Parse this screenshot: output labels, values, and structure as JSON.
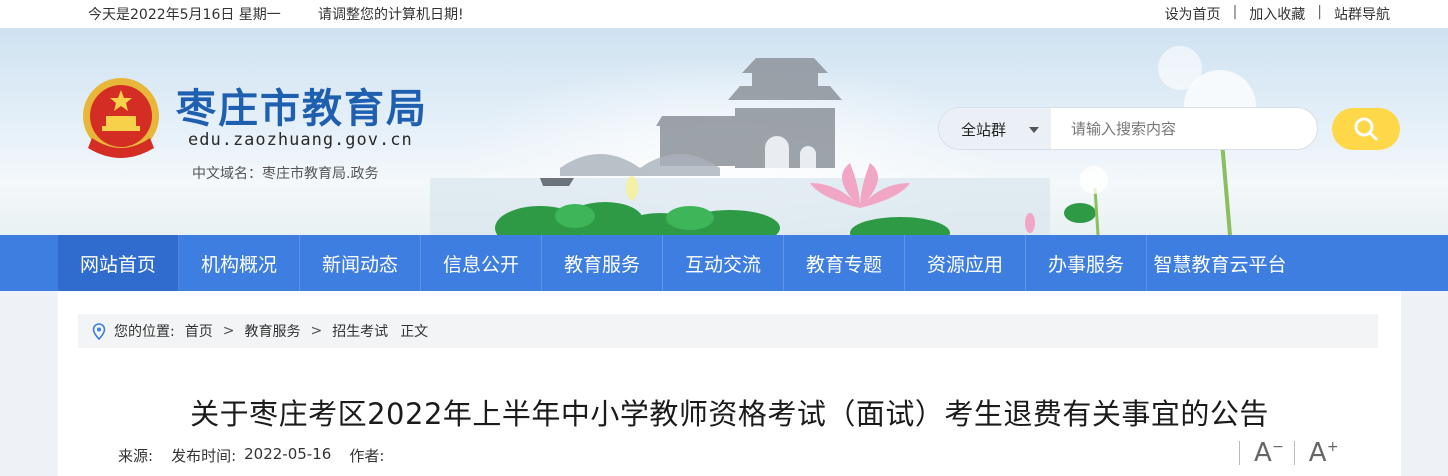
{
  "topbar": {
    "date": "今天是2022年5月16日 星期一",
    "notice": "请调整您的计算机日期!",
    "links": [
      "设为首页",
      "加入收藏",
      "站群导航"
    ]
  },
  "header": {
    "title": "枣庄市教育局",
    "domain": "edu.zaozhuang.gov.cn",
    "cn_domain": "中文域名：枣庄市教育局.政务",
    "emblem_icon": "national-emblem-icon"
  },
  "search": {
    "scope": "全站群",
    "placeholder": "请输入搜索内容",
    "button_icon": "search-icon"
  },
  "nav": {
    "items": [
      "网站首页",
      "机构概况",
      "新闻动态",
      "信息公开",
      "教育服务",
      "互动交流",
      "教育专题",
      "资源应用",
      "办事服务",
      "智慧教育云平台"
    ]
  },
  "breadcrumb": {
    "prefix": "您的位置:",
    "items": [
      "首页",
      "教育服务",
      "招生考试",
      "正文"
    ]
  },
  "article": {
    "title": "关于枣庄考区2022年上半年中小学教师资格考试（面试）考生退费有关事宜的公告",
    "source_label": "来源:",
    "source_value": "",
    "publish_label": "发布时间:",
    "publish_value": "2022-05-16",
    "author_label": "作者:",
    "author_value": ""
  },
  "font_controls": {
    "decrease": "A",
    "decrease_mark": "−",
    "increase": "A",
    "increase_mark": "+"
  },
  "colors": {
    "nav_bg": "#3d7ee0",
    "title_blue": "#1f5fb0",
    "search_btn": "#ffd84a"
  }
}
